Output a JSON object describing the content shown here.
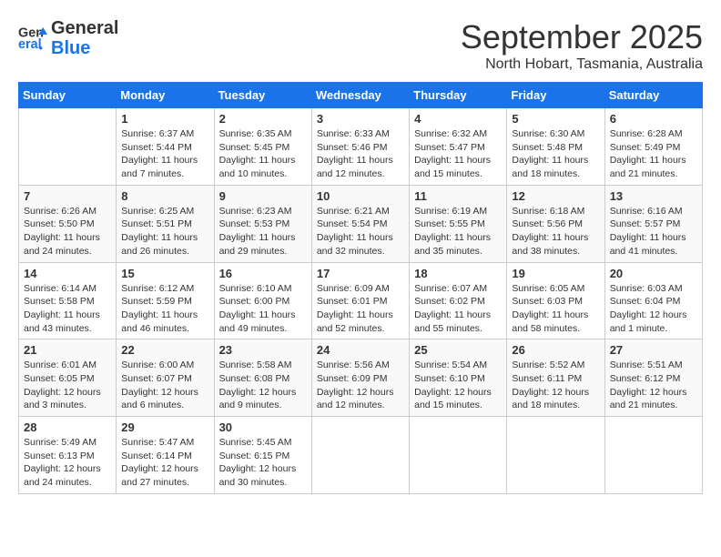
{
  "header": {
    "logo_line1": "General",
    "logo_line2": "Blue",
    "month": "September 2025",
    "location": "North Hobart, Tasmania, Australia"
  },
  "weekdays": [
    "Sunday",
    "Monday",
    "Tuesday",
    "Wednesday",
    "Thursday",
    "Friday",
    "Saturday"
  ],
  "weeks": [
    [
      {
        "day": "",
        "sunrise": "",
        "sunset": "",
        "daylight": ""
      },
      {
        "day": "1",
        "sunrise": "Sunrise: 6:37 AM",
        "sunset": "Sunset: 5:44 PM",
        "daylight": "Daylight: 11 hours and 7 minutes."
      },
      {
        "day": "2",
        "sunrise": "Sunrise: 6:35 AM",
        "sunset": "Sunset: 5:45 PM",
        "daylight": "Daylight: 11 hours and 10 minutes."
      },
      {
        "day": "3",
        "sunrise": "Sunrise: 6:33 AM",
        "sunset": "Sunset: 5:46 PM",
        "daylight": "Daylight: 11 hours and 12 minutes."
      },
      {
        "day": "4",
        "sunrise": "Sunrise: 6:32 AM",
        "sunset": "Sunset: 5:47 PM",
        "daylight": "Daylight: 11 hours and 15 minutes."
      },
      {
        "day": "5",
        "sunrise": "Sunrise: 6:30 AM",
        "sunset": "Sunset: 5:48 PM",
        "daylight": "Daylight: 11 hours and 18 minutes."
      },
      {
        "day": "6",
        "sunrise": "Sunrise: 6:28 AM",
        "sunset": "Sunset: 5:49 PM",
        "daylight": "Daylight: 11 hours and 21 minutes."
      }
    ],
    [
      {
        "day": "7",
        "sunrise": "Sunrise: 6:26 AM",
        "sunset": "Sunset: 5:50 PM",
        "daylight": "Daylight: 11 hours and 24 minutes."
      },
      {
        "day": "8",
        "sunrise": "Sunrise: 6:25 AM",
        "sunset": "Sunset: 5:51 PM",
        "daylight": "Daylight: 11 hours and 26 minutes."
      },
      {
        "day": "9",
        "sunrise": "Sunrise: 6:23 AM",
        "sunset": "Sunset: 5:53 PM",
        "daylight": "Daylight: 11 hours and 29 minutes."
      },
      {
        "day": "10",
        "sunrise": "Sunrise: 6:21 AM",
        "sunset": "Sunset: 5:54 PM",
        "daylight": "Daylight: 11 hours and 32 minutes."
      },
      {
        "day": "11",
        "sunrise": "Sunrise: 6:19 AM",
        "sunset": "Sunset: 5:55 PM",
        "daylight": "Daylight: 11 hours and 35 minutes."
      },
      {
        "day": "12",
        "sunrise": "Sunrise: 6:18 AM",
        "sunset": "Sunset: 5:56 PM",
        "daylight": "Daylight: 11 hours and 38 minutes."
      },
      {
        "day": "13",
        "sunrise": "Sunrise: 6:16 AM",
        "sunset": "Sunset: 5:57 PM",
        "daylight": "Daylight: 11 hours and 41 minutes."
      }
    ],
    [
      {
        "day": "14",
        "sunrise": "Sunrise: 6:14 AM",
        "sunset": "Sunset: 5:58 PM",
        "daylight": "Daylight: 11 hours and 43 minutes."
      },
      {
        "day": "15",
        "sunrise": "Sunrise: 6:12 AM",
        "sunset": "Sunset: 5:59 PM",
        "daylight": "Daylight: 11 hours and 46 minutes."
      },
      {
        "day": "16",
        "sunrise": "Sunrise: 6:10 AM",
        "sunset": "Sunset: 6:00 PM",
        "daylight": "Daylight: 11 hours and 49 minutes."
      },
      {
        "day": "17",
        "sunrise": "Sunrise: 6:09 AM",
        "sunset": "Sunset: 6:01 PM",
        "daylight": "Daylight: 11 hours and 52 minutes."
      },
      {
        "day": "18",
        "sunrise": "Sunrise: 6:07 AM",
        "sunset": "Sunset: 6:02 PM",
        "daylight": "Daylight: 11 hours and 55 minutes."
      },
      {
        "day": "19",
        "sunrise": "Sunrise: 6:05 AM",
        "sunset": "Sunset: 6:03 PM",
        "daylight": "Daylight: 11 hours and 58 minutes."
      },
      {
        "day": "20",
        "sunrise": "Sunrise: 6:03 AM",
        "sunset": "Sunset: 6:04 PM",
        "daylight": "Daylight: 12 hours and 1 minute."
      }
    ],
    [
      {
        "day": "21",
        "sunrise": "Sunrise: 6:01 AM",
        "sunset": "Sunset: 6:05 PM",
        "daylight": "Daylight: 12 hours and 3 minutes."
      },
      {
        "day": "22",
        "sunrise": "Sunrise: 6:00 AM",
        "sunset": "Sunset: 6:07 PM",
        "daylight": "Daylight: 12 hours and 6 minutes."
      },
      {
        "day": "23",
        "sunrise": "Sunrise: 5:58 AM",
        "sunset": "Sunset: 6:08 PM",
        "daylight": "Daylight: 12 hours and 9 minutes."
      },
      {
        "day": "24",
        "sunrise": "Sunrise: 5:56 AM",
        "sunset": "Sunset: 6:09 PM",
        "daylight": "Daylight: 12 hours and 12 minutes."
      },
      {
        "day": "25",
        "sunrise": "Sunrise: 5:54 AM",
        "sunset": "Sunset: 6:10 PM",
        "daylight": "Daylight: 12 hours and 15 minutes."
      },
      {
        "day": "26",
        "sunrise": "Sunrise: 5:52 AM",
        "sunset": "Sunset: 6:11 PM",
        "daylight": "Daylight: 12 hours and 18 minutes."
      },
      {
        "day": "27",
        "sunrise": "Sunrise: 5:51 AM",
        "sunset": "Sunset: 6:12 PM",
        "daylight": "Daylight: 12 hours and 21 minutes."
      }
    ],
    [
      {
        "day": "28",
        "sunrise": "Sunrise: 5:49 AM",
        "sunset": "Sunset: 6:13 PM",
        "daylight": "Daylight: 12 hours and 24 minutes."
      },
      {
        "day": "29",
        "sunrise": "Sunrise: 5:47 AM",
        "sunset": "Sunset: 6:14 PM",
        "daylight": "Daylight: 12 hours and 27 minutes."
      },
      {
        "day": "30",
        "sunrise": "Sunrise: 5:45 AM",
        "sunset": "Sunset: 6:15 PM",
        "daylight": "Daylight: 12 hours and 30 minutes."
      },
      {
        "day": "",
        "sunrise": "",
        "sunset": "",
        "daylight": ""
      },
      {
        "day": "",
        "sunrise": "",
        "sunset": "",
        "daylight": ""
      },
      {
        "day": "",
        "sunrise": "",
        "sunset": "",
        "daylight": ""
      },
      {
        "day": "",
        "sunrise": "",
        "sunset": "",
        "daylight": ""
      }
    ]
  ]
}
